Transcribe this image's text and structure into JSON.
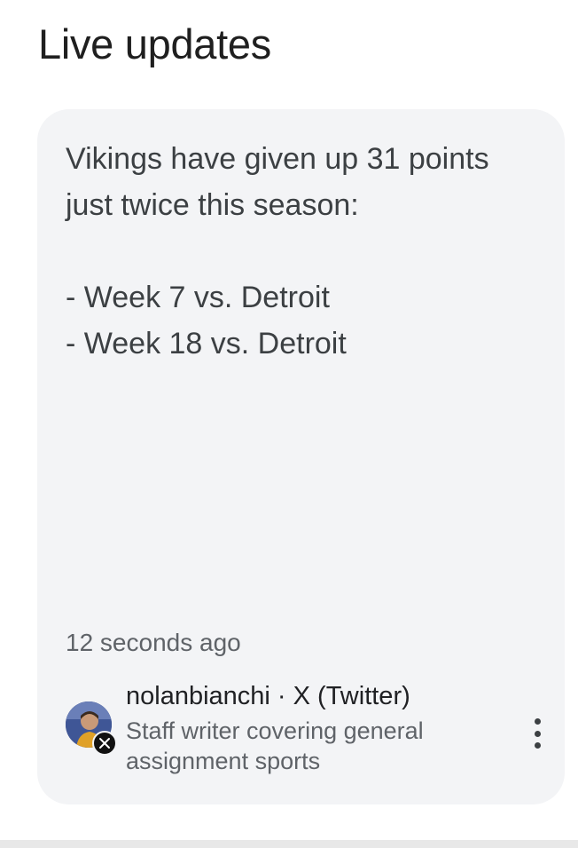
{
  "section": {
    "title": "Live updates"
  },
  "post": {
    "lines": [
      "Vikings have given up 31 points",
      "just twice this season:",
      "- Week 7 vs. Detroit",
      "- Week 18 vs. Detroit"
    ],
    "timestamp": "12 seconds ago"
  },
  "author": {
    "handle": "nolanbianchi",
    "separator": " · ",
    "source": "X (Twitter)",
    "bio": "Staff writer covering general assignment sports",
    "avatar_icon": "user-avatar",
    "source_icon": "x-logo-icon"
  },
  "menu": {
    "icon": "more-vertical-icon"
  },
  "colors": {
    "card_bg": "#f3f4f6",
    "text_primary": "#202124",
    "text_secondary": "#5f6368"
  }
}
